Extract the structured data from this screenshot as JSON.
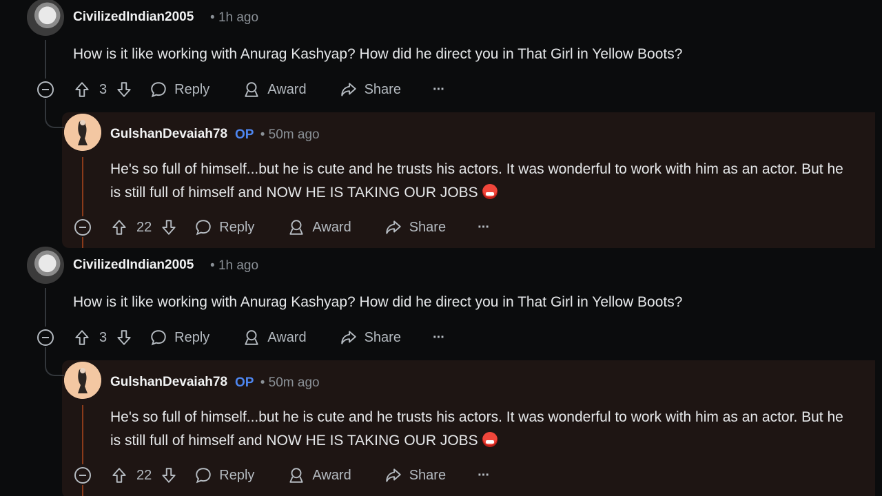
{
  "threads": [
    {
      "parent": {
        "author": "CivilizedIndian2005",
        "time": "1h ago",
        "body": "How is it like working with Anurag Kashyap? How did he direct you in That Girl in Yellow Boots?",
        "votes": "3",
        "reply_label": "Reply",
        "award_label": "Award",
        "share_label": "Share",
        "more_label": "···"
      },
      "reply": {
        "author": "GulshanDevaiah78",
        "op_badge": "OP",
        "time": "50m ago",
        "body": "He's so full of himself...but he is cute and he trusts his actors. It was wonderful to work with him as an actor. But he is still full of himself and NOW HE IS TAKING OUR JOBS",
        "votes": "22",
        "reply_label": "Reply",
        "award_label": "Award",
        "share_label": "Share",
        "more_label": "···"
      }
    },
    {
      "parent": {
        "author": "CivilizedIndian2005",
        "time": "1h ago",
        "body": "How is it like working with Anurag Kashyap? How did he direct you in That Girl in Yellow Boots?",
        "votes": "3",
        "reply_label": "Reply",
        "award_label": "Award",
        "share_label": "Share",
        "more_label": "···"
      },
      "reply": {
        "author": "GulshanDevaiah78",
        "op_badge": "OP",
        "time": "50m ago",
        "body": "He's so full of himself...but he is cute and he trusts his actors. It was wonderful to work with him as an actor. But he is still full of himself and NOW HE IS TAKING OUR JOBS",
        "votes": "22",
        "reply_label": "Reply",
        "award_label": "Award",
        "share_label": "Share",
        "more_label": "···"
      }
    }
  ],
  "separator": "•",
  "icons": {
    "upvote": "upvote-arrow-icon",
    "downvote": "downvote-arrow-icon",
    "reply": "comment-bubble-icon",
    "award": "award-ribbon-icon",
    "share": "share-arrow-icon",
    "collapse": "collapse-minus-icon",
    "emoji": "angry-face-emoji-icon"
  },
  "colors": {
    "background": "#0b0c0d",
    "reply_highlight": "#1e1513",
    "op_badge": "#4e86f0",
    "op_thread_line": "#8a3a1a"
  }
}
